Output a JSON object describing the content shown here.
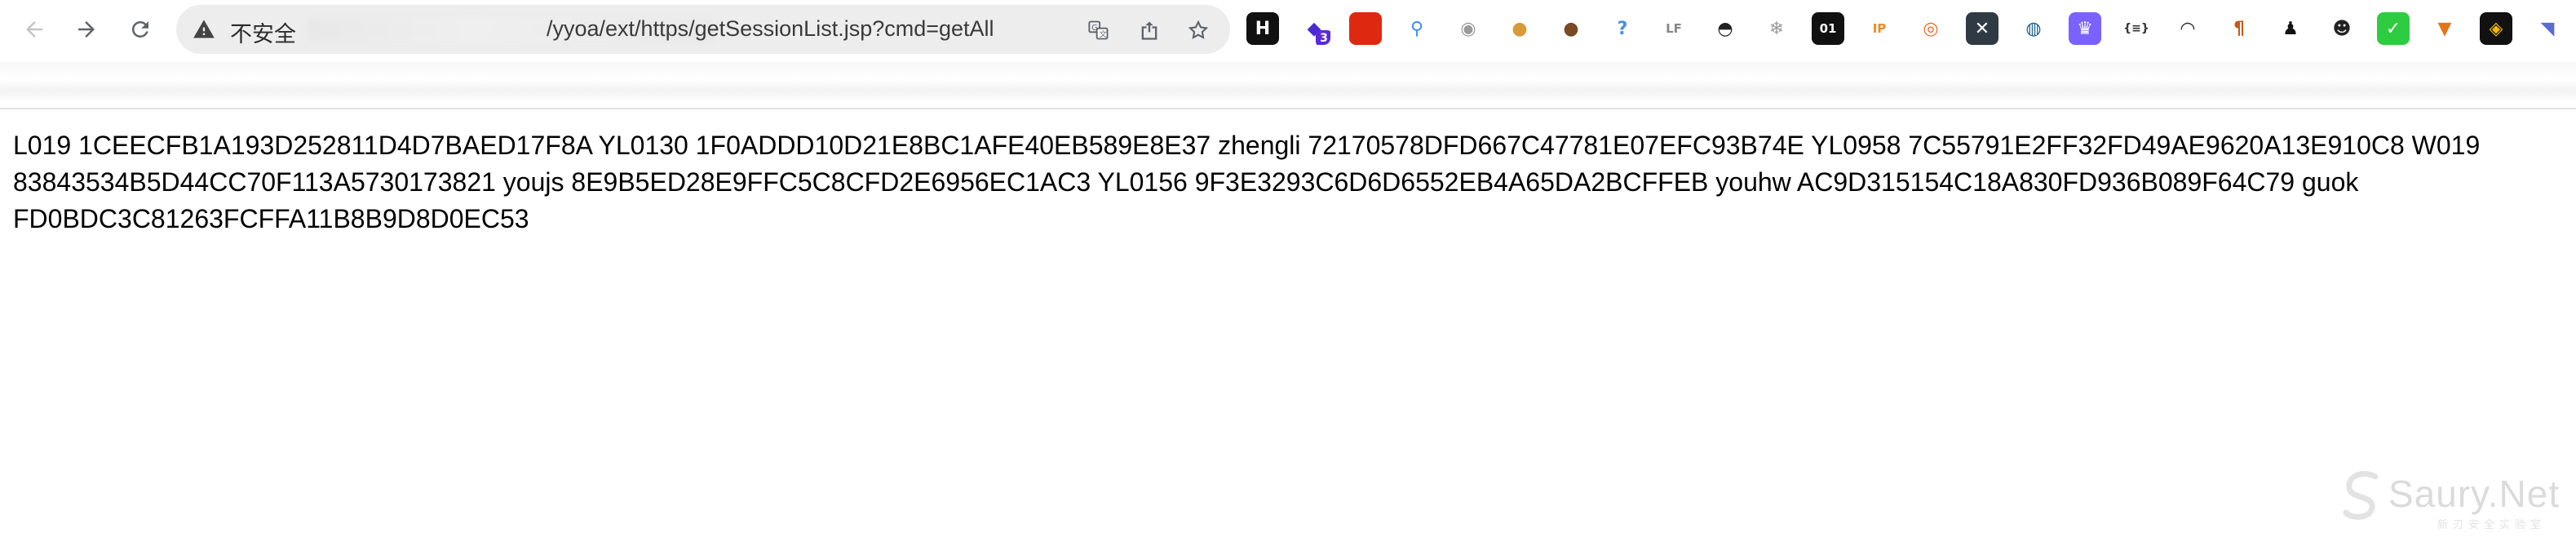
{
  "browser": {
    "address_bar": {
      "security_label": "不安全",
      "url_path": "/yyoa/ext/https/getSessionList.jsp?cmd=getAll"
    },
    "extensions": [
      {
        "name": "h-icon",
        "glyph": "H",
        "bg": "#111111",
        "fg": "#ffffff"
      },
      {
        "name": "stack-icon",
        "glyph": "◆",
        "bg": "#ffffff",
        "fg": "#4b2bd0",
        "badge": "3"
      },
      {
        "name": "china-flag-icon",
        "glyph": "",
        "bg": "#de2910",
        "fg": "#ffde00"
      },
      {
        "name": "pin-icon",
        "glyph": "⚲",
        "bg": "#ffffff",
        "fg": "#3d8ef0"
      },
      {
        "name": "circle-icon",
        "glyph": "◉",
        "bg": "#ffffff",
        "fg": "#9a9a9a"
      },
      {
        "name": "cookie-icon",
        "glyph": "●",
        "bg": "#ffffff",
        "fg": "#d99a3a"
      },
      {
        "name": "cookie-editor-icon",
        "glyph": "●",
        "bg": "#ffffff",
        "fg": "#7a4a23"
      },
      {
        "name": "question-icon",
        "glyph": "?",
        "bg": "#ffffff",
        "fg": "#4a90d9"
      },
      {
        "name": "lf-icon",
        "glyph": "LF",
        "bg": "#ffffff",
        "fg": "#888888"
      },
      {
        "name": "mask-icon",
        "glyph": "◓",
        "bg": "#ffffff",
        "fg": "#222222"
      },
      {
        "name": "snowflake-icon",
        "glyph": "❄",
        "bg": "#ffffff",
        "fg": "#9a9a9a"
      },
      {
        "name": "binary-icon",
        "glyph": "01",
        "bg": "#111111",
        "fg": "#ffffff"
      },
      {
        "name": "ip-icon",
        "glyph": "IP",
        "bg": "#ffffff",
        "fg": "#f08a24"
      },
      {
        "name": "lifebuoy-icon",
        "glyph": "◎",
        "bg": "#ffffff",
        "fg": "#f06a25"
      },
      {
        "name": "x-icon",
        "glyph": "✕",
        "bg": "#2f3a44",
        "fg": "#ffffff"
      },
      {
        "name": "globe-icon",
        "glyph": "◍",
        "bg": "#ffffff",
        "fg": "#1b5e8c"
      },
      {
        "name": "crown-icon",
        "glyph": "♛",
        "bg": "#7b61ff",
        "fg": "#ffffff"
      },
      {
        "name": "json-icon",
        "glyph": "{≡}",
        "bg": "#ffffff",
        "fg": "#333333"
      },
      {
        "name": "hat-icon",
        "glyph": "◠",
        "bg": "#ffffff",
        "fg": "#222222"
      },
      {
        "name": "pilcrow-icon",
        "glyph": "¶",
        "bg": "#ffffff",
        "fg": "#c25a1a"
      },
      {
        "name": "hacker-icon",
        "glyph": "♟",
        "bg": "#ffffff",
        "fg": "#111111"
      },
      {
        "name": "panda-icon",
        "glyph": "☻",
        "bg": "#ffffff",
        "fg": "#222222"
      },
      {
        "name": "check-icon",
        "glyph": "✓",
        "bg": "#2ecc40",
        "fg": "#ffffff"
      },
      {
        "name": "fox-icon",
        "glyph": "▼",
        "bg": "#ffffff",
        "fg": "#e2761b"
      },
      {
        "name": "binance-icon",
        "glyph": "◈",
        "bg": "#111111",
        "fg": "#f0b90b"
      },
      {
        "name": "puzzle-icon",
        "glyph": "◥",
        "bg": "#ffffff",
        "fg": "#5b6bd6"
      }
    ]
  },
  "page": {
    "content": "L019 1CEECFB1A193D252811D4D7BAED17F8A YL0130 1F0ADDD10D21E8BC1AFE40EB589E8E37 zhengli 72170578DFD667C47781E07EFC93B74E YL0958 7C55791E2FF32FD49AE9620A13E910C8 W019 83843534B5D44CC70F113A5730173821 youjs 8E9B5ED28E9FFC5C8CFD2E6956EC1AC3 YL0156 9F3E3293C6D6D6552EB4A65DA2BCFFEB youhw AC9D315154C18A830FD936B089F64C79 guok FD0BDC3C81263FCFFA11B8B9D8D0EC53"
  },
  "watermark": {
    "text": "Saury.Net",
    "sub": "新刃安全实验室"
  }
}
